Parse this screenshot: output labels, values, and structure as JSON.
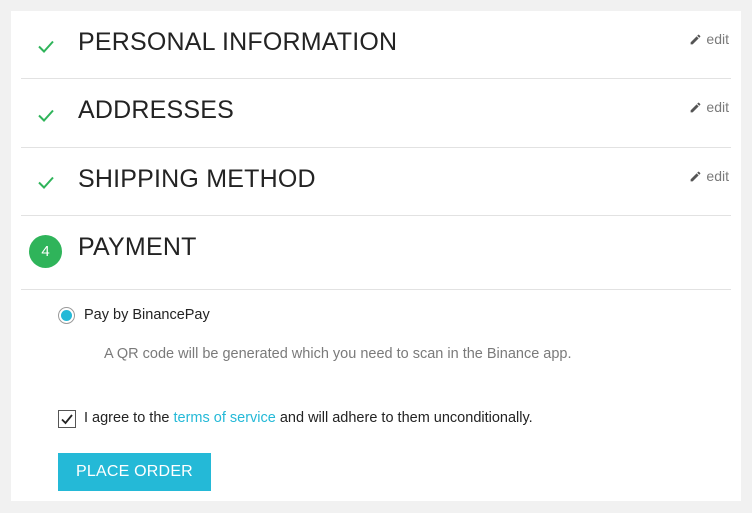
{
  "steps": [
    {
      "title": "PERSONAL INFORMATION",
      "edit": "edit",
      "status": "complete"
    },
    {
      "title": "ADDRESSES",
      "edit": "edit",
      "status": "complete"
    },
    {
      "title": "SHIPPING METHOD",
      "edit": "edit",
      "status": "complete"
    },
    {
      "title": "PAYMENT",
      "number": "4",
      "status": "current"
    }
  ],
  "payment": {
    "option_label": "Pay by BinancePay",
    "option_selected": true,
    "option_description": "A QR code will be generated which you need to scan in the Binance app."
  },
  "terms": {
    "checked": true,
    "prefix": "I agree to the ",
    "link": "terms of service",
    "suffix": " and will adhere to them unconditionally."
  },
  "place_order_label": "PLACE ORDER",
  "colors": {
    "check_green": "#2fb45a",
    "accent_cyan": "#24b9d7",
    "background": "#f1f1f1"
  },
  "icons": {
    "complete": "check-icon",
    "edit": "pencil-icon"
  }
}
